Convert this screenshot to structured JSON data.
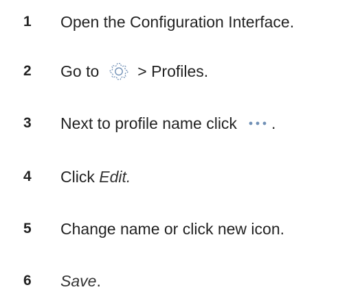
{
  "steps": [
    {
      "num": "1",
      "text": "Open the Configuration Interface."
    },
    {
      "num": "2",
      "text_before": "Go to",
      "icon": "gear-icon",
      "text_after": "> Profiles."
    },
    {
      "num": "3",
      "text_before": "Next to profile name click",
      "icon": "more-dots-icon",
      "text_after": "."
    },
    {
      "num": "4",
      "text_before": "Click",
      "text_italic": "Edit."
    },
    {
      "num": "5",
      "text": "Change name or click new icon."
    },
    {
      "num": "6",
      "text_italic": "Save",
      "text_after": "."
    }
  ],
  "colors": {
    "text": "#222222",
    "icon_accent": "#6f8fb5"
  }
}
